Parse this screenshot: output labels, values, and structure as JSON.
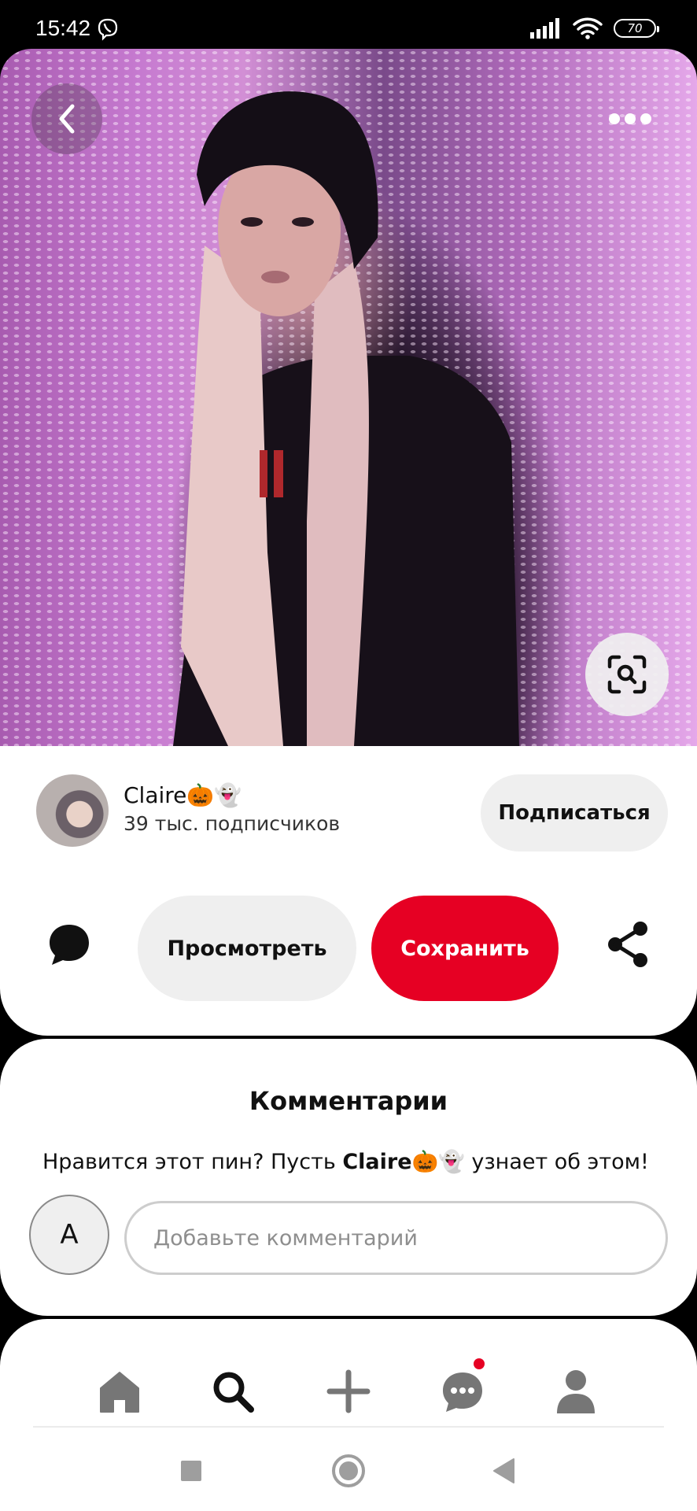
{
  "status_bar": {
    "time": "15:42",
    "battery": "70",
    "icons": [
      "viber-icon",
      "signal-icon",
      "wifi-icon",
      "battery-icon"
    ]
  },
  "pin": {
    "image_alt": "Pin image",
    "actions": {
      "back": "back-arrow-icon",
      "more": "more-dots-icon",
      "visual_search": "visual-search-icon"
    }
  },
  "creator": {
    "name": "Claire🎃👻",
    "followers": "39 тыс. подписчиков",
    "subscribe_label": "Подписаться"
  },
  "actions": {
    "view_label": "Просмотреть",
    "save_label": "Сохранить",
    "save_color": "#e60023"
  },
  "comments": {
    "title": "Комментарии",
    "prompt_before": "Нравится этот пин? Пусть ",
    "prompt_name": "Claire🎃👻",
    "prompt_after": " узнает об этом!",
    "user_initial": "A",
    "input_placeholder": "Добавьте комментарий"
  },
  "bottom_nav": {
    "items": [
      "home-icon",
      "search-icon",
      "add-icon",
      "messages-icon",
      "profile-icon"
    ],
    "notification_color": "#e60023"
  },
  "system_nav": [
    "recents-icon",
    "home-circle-icon",
    "back-triangle-icon"
  ]
}
